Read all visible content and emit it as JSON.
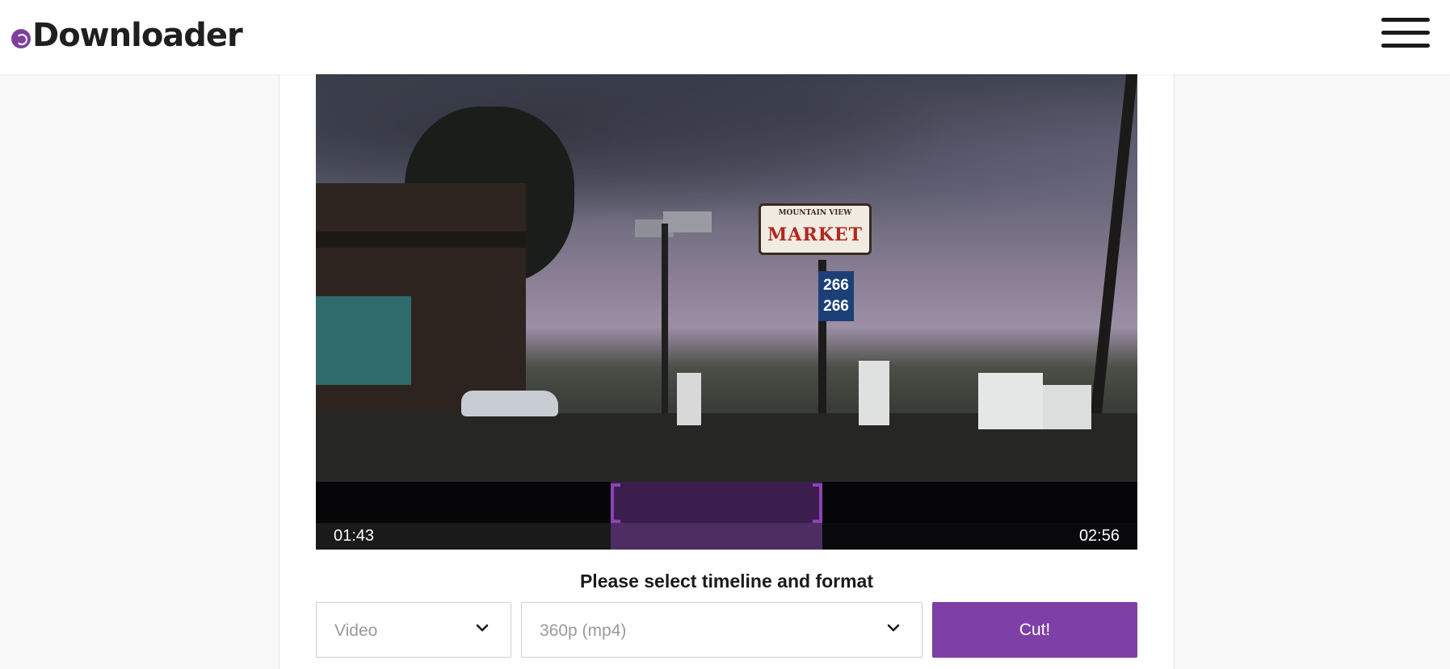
{
  "header": {
    "logo_text": "Downloader",
    "logo_icon": "e-logo-icon",
    "menu_icon": "hamburger-menu-icon"
  },
  "video": {
    "sign_small": "MOUNTAIN VIEW",
    "sign_main": "MARKET",
    "price_top": "266",
    "price_bottom": "266"
  },
  "timeline": {
    "start_time": "01:43",
    "end_time": "02:56",
    "selection_color": "#8c43b6"
  },
  "controls": {
    "prompt": "Please select timeline and format",
    "type_select": {
      "value": "Video",
      "icon": "chevron-down-icon"
    },
    "format_select": {
      "value": "360p (mp4)",
      "icon": "chevron-down-icon"
    },
    "cut_button": "Cut!"
  },
  "colors": {
    "accent": "#7e3fa6",
    "background": "#f9f9f9"
  }
}
